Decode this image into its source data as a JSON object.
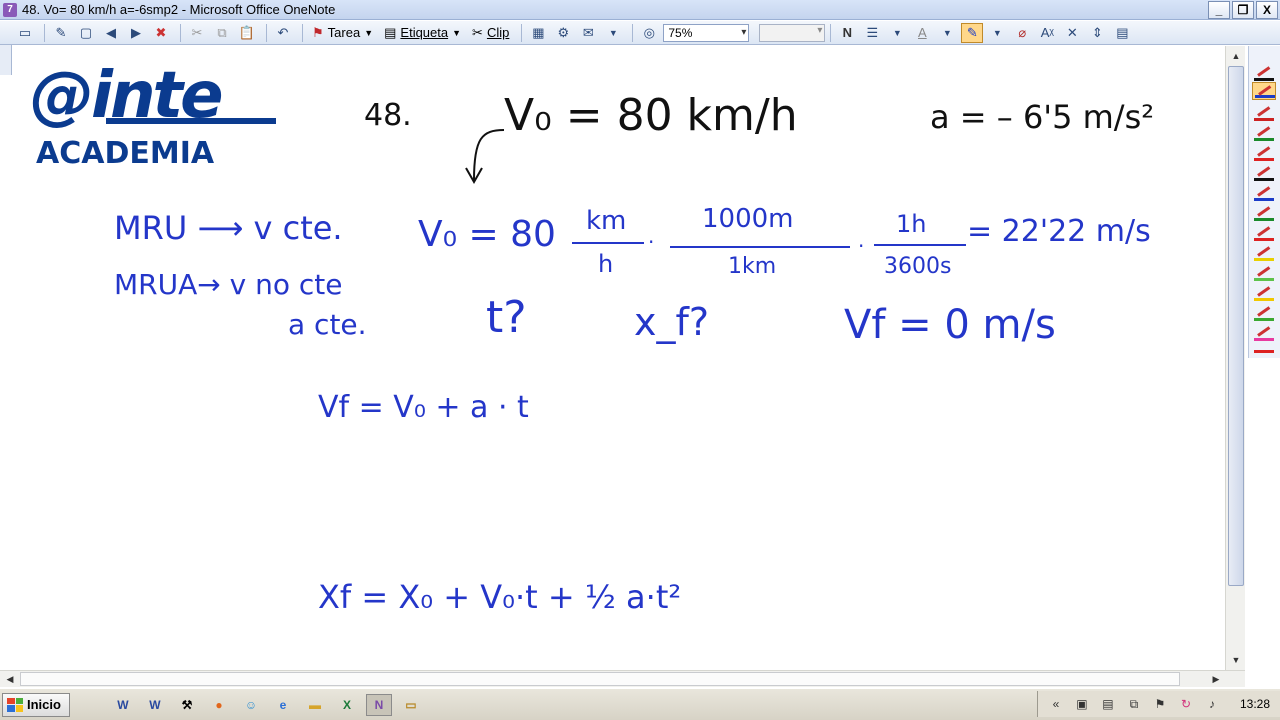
{
  "window": {
    "title": "48. Vo= 80 km/h a=-6smp2 - Microsoft Office OneNote",
    "controls": [
      "_",
      "❐",
      "X"
    ]
  },
  "toolbar": {
    "tarea_label": "Tarea",
    "etiqueta_label": "Etiqueta",
    "clip_label": "Clip",
    "zoom_value": "75%",
    "pen_bold_icon": "N",
    "font_color_icon": "A"
  },
  "logo": {
    "mark": "@inte",
    "sub": "ACADEMIA"
  },
  "ink": {
    "problem_number": "48.",
    "v0_given": "V₀ = 80  km/h",
    "a_given": "a = – 6'5 m/s²",
    "mru": "MRU ⟶ v cte.",
    "mrua": "MRUA→ v no cte",
    "a_cte": "a cte.",
    "conversion_lhs": "V₀ = 80",
    "km": "km",
    "h": "h",
    "m1000": "1000m",
    "km1": "1km",
    "h1": "1h",
    "s3600": "3600s",
    "result": "= 22'22 m/s",
    "t_question": "t?",
    "xf_question": "x_f?",
    "vf_zero": "Vf = 0  m/s",
    "eq_vf": "Vf = V₀ + a · t",
    "eq_xf": "Xf = X₀ + V₀·t + ½ a·t²"
  },
  "taskbar": {
    "start_label": "Inicio",
    "clock": "13:28"
  }
}
